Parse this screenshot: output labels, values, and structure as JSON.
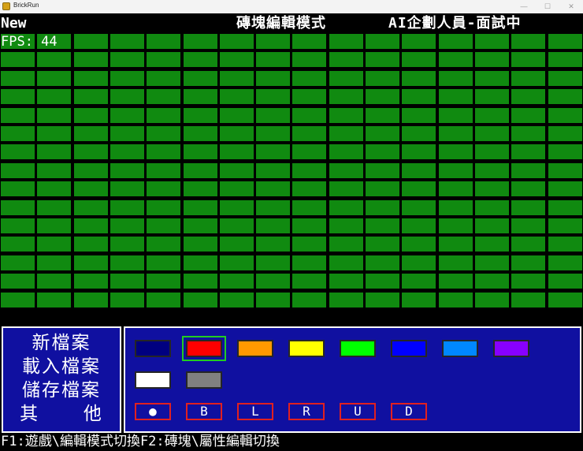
{
  "window": {
    "title": "BrickRun",
    "minimize_glyph": "—",
    "maximize_glyph": "☐",
    "close_glyph": "✕"
  },
  "hud": {
    "level_name": "New",
    "mode": "磚塊編輯模式",
    "role": "AI企劃人員-面試中",
    "fps": "FPS: 44"
  },
  "grid": {
    "rows": 15,
    "cols": 16,
    "brick_color": "#108a10"
  },
  "menu": {
    "new": "新檔案",
    "load": "載入檔案",
    "save": "儲存檔案",
    "other": "其 他"
  },
  "palette": {
    "colors": [
      {
        "name": "navy",
        "hex": "#000080",
        "selected": false
      },
      {
        "name": "red",
        "hex": "#ff0000",
        "selected": true
      },
      {
        "name": "orange",
        "hex": "#ff9900",
        "selected": false
      },
      {
        "name": "yellow",
        "hex": "#ffff00",
        "selected": false
      },
      {
        "name": "green",
        "hex": "#00ff00",
        "selected": false
      },
      {
        "name": "blue",
        "hex": "#0000ff",
        "selected": false
      },
      {
        "name": "sky-blue",
        "hex": "#0088ff",
        "selected": false
      },
      {
        "name": "purple",
        "hex": "#8800ff",
        "selected": false
      },
      {
        "name": "white",
        "hex": "#ffffff",
        "selected": false
      },
      {
        "name": "gray",
        "hex": "#808080",
        "selected": false
      }
    ],
    "attributes": [
      "●",
      "B",
      "L",
      "R",
      "U",
      "D"
    ]
  },
  "footer": {
    "hint": "F1:遊戲\\編輯模式切換F2:磚塊\\屬性編輯切換"
  }
}
